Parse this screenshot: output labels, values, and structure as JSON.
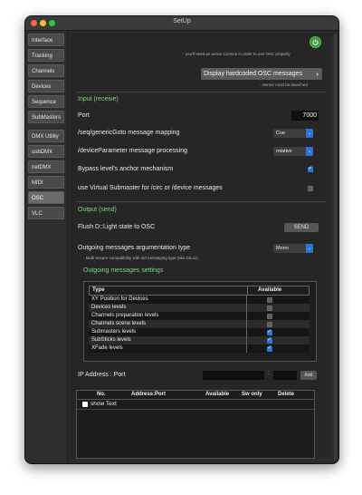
{
  "window": {
    "title": "SetUp"
  },
  "sidebar": {
    "items": [
      {
        "label": "Interface",
        "active": false
      },
      {
        "label": "Tracking",
        "active": false
      },
      {
        "label": "Channels",
        "active": false
      },
      {
        "label": "Devices",
        "active": false
      },
      {
        "label": "Sequence",
        "active": false
      },
      {
        "label": "SubMasters",
        "active": false
      },
      {
        "label": "DMX Utility",
        "active": false
      },
      {
        "label": "usbDMX",
        "active": false
      },
      {
        "label": "netDMX",
        "active": false
      },
      {
        "label": "MIDI",
        "active": false
      },
      {
        "label": "OSC",
        "active": true
      },
      {
        "label": "VLC",
        "active": false
      }
    ]
  },
  "header": {
    "licence_note": "- you'll need an active Licence in order to use OSC properly",
    "display_button": "Display hardcoded OSC messages",
    "server_note": "- Server must be launched"
  },
  "input": {
    "section_title": "Input (receive)",
    "port_label": "Port",
    "port_value": "7000",
    "seq_label": "/seq/genericGoto message mapping",
    "seq_value": "Cue",
    "device_label": "/deviceParameter message processing",
    "device_value": "relative",
    "bypass_label": "Bypass level's anchor mechanism",
    "bypass_checked": true,
    "virtual_label": "use Virtual Submaster for /circ or /device messages",
    "virtual_checked": false
  },
  "output": {
    "section_title": "Output (send)",
    "flush_label": "Flush D::Light state to OSC",
    "send_label": "SEND",
    "arg_label": "Outgoing messages argumentation type",
    "arg_value": "Mono",
    "arg_note": "- Multi ensure compatibility with old messaging type (aka DiLuz)",
    "settings_title": "Outgoing messages settings",
    "table_headers": [
      "Type",
      "Available"
    ],
    "rows": [
      {
        "type": "XY Position for Devices",
        "available": false
      },
      {
        "type": "Devices levels",
        "available": false
      },
      {
        "type": "Channels preparation levels",
        "available": false
      },
      {
        "type": "Channels scene levels",
        "available": false
      },
      {
        "type": "Submasters levels",
        "available": true
      },
      {
        "type": "SubSticks levels",
        "available": true
      },
      {
        "type": "XFade levels",
        "available": true
      }
    ]
  },
  "ip": {
    "label": "IP Address : Port",
    "dots": [
      ".",
      ".",
      "."
    ],
    "colon": ":",
    "add_label": "Add",
    "headers": [
      "No.",
      "Address:Port",
      "Available",
      "Sw only",
      "Delete"
    ],
    "show_text": "show Text"
  }
}
